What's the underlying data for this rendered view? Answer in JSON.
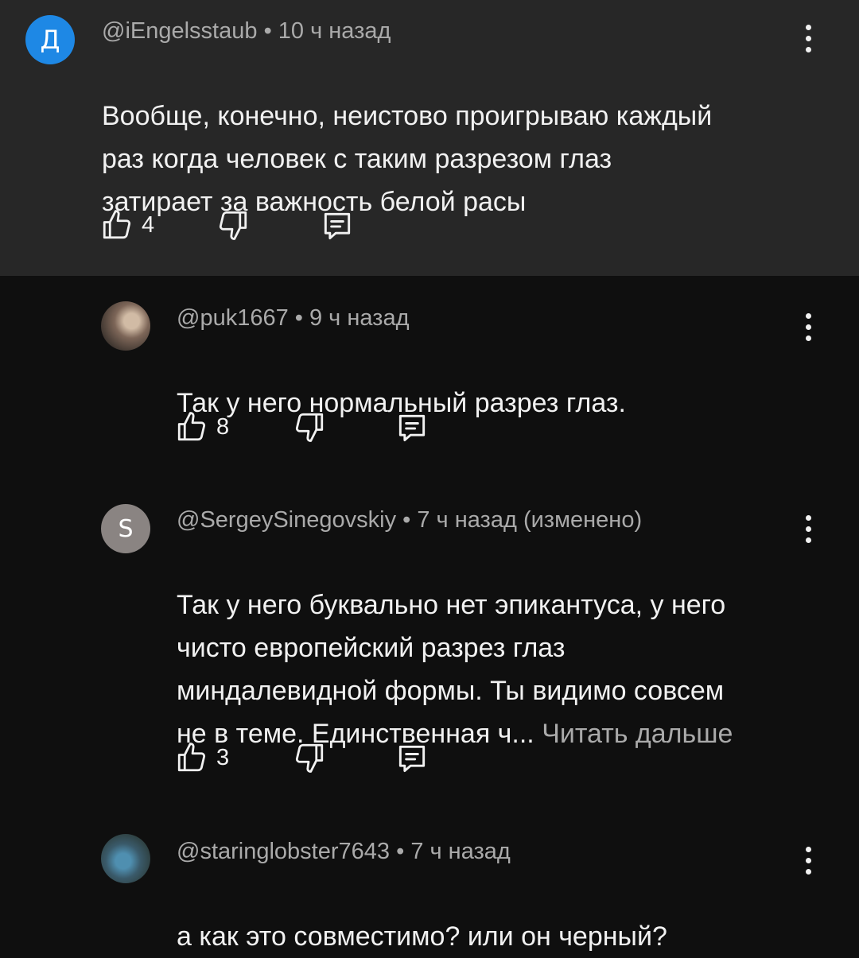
{
  "comments": [
    {
      "avatar_letter": "Д",
      "author": "@iEngelsstaub",
      "time": "10 ч назад",
      "edited": "",
      "text": "Вообще, конечно, неистово проигрываю каждый\nраз когда человек с таким разрезом глаз\nзатирает за важность белой расы",
      "more_link": "",
      "likes": "4"
    },
    {
      "avatar_letter": "",
      "author": "@puk1667",
      "time": "9 ч назад",
      "edited": "",
      "text": "Так у него нормальный разрез глаз.",
      "more_link": "",
      "likes": "8"
    },
    {
      "avatar_letter": "S",
      "author": "@SergeySinegovskiy",
      "time": "7 ч назад",
      "edited": "(изменено)",
      "text": "Так у него буквально нет эпикантуса, у него\nчисто европейский разрез глаз\nминдалевидной формы. Ты видимо совсем\nне в теме. Единственная ч... ",
      "more_link": "Читать дальше",
      "likes": "3"
    },
    {
      "avatar_letter": "",
      "author": "@staringlobster7643",
      "time": "7 ч назад",
      "edited": "",
      "text": "а как это совместимо? или он черный?",
      "more_link": "",
      "likes": ""
    }
  ],
  "separator": "•",
  "icons": {
    "like": "thumb-up-icon",
    "dislike": "thumb-down-icon",
    "reply": "reply-comment-icon",
    "menu": "more-vert-icon"
  },
  "colors": {
    "background": "#0f0f0f",
    "top_comment_bg": "#272727",
    "avatar_d": "#1e88e5",
    "avatar_s": "#8a8482",
    "meta_text": "#aaaaaa",
    "text": "#f1f1f1"
  }
}
